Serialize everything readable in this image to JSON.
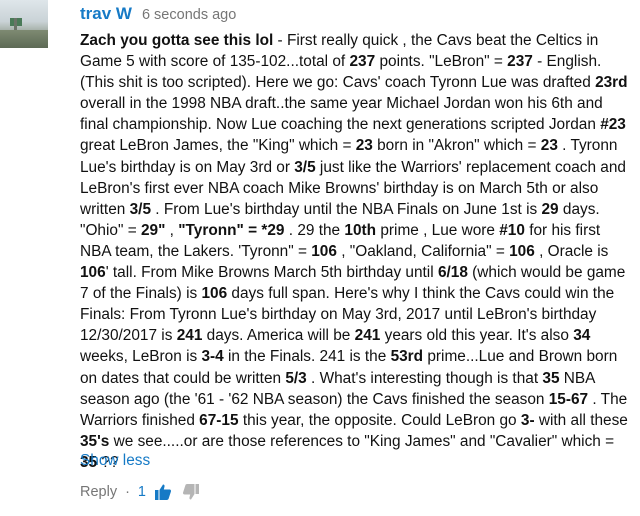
{
  "comment": {
    "author": "trav W",
    "time": "6 seconds ago",
    "segments": [
      {
        "t": "Zach you gotta see this lol",
        "b": true
      },
      {
        "t": " - First really quick , the Cavs beat the Celtics in Game 5 with score of  135-102...total of "
      },
      {
        "t": "237",
        "b": true
      },
      {
        "t": " points. \"LeBron\" = "
      },
      {
        "t": "237",
        "b": true
      },
      {
        "t": " - English. (This shit is too scripted). Here we go: Cavs' coach Tyronn Lue was drafted "
      },
      {
        "t": "23rd",
        "b": true
      },
      {
        "t": " overall in the 1998 NBA draft..the same year Michael Jordan won his 6th and final championship. Now Lue coaching the next generations scripted Jordan "
      },
      {
        "t": "#23",
        "b": true
      },
      {
        "t": " great LeBron James, the \"King\" which = "
      },
      {
        "t": "23",
        "b": true
      },
      {
        "t": " born in \"Akron\" which = "
      },
      {
        "t": "23",
        "b": true
      },
      {
        "t": " .  Tyronn Lue's birthday is on May 3rd or "
      },
      {
        "t": "3/5",
        "b": true
      },
      {
        "t": " just like the Warriors' replacement coach and LeBron's first ever NBA coach Mike Browns' birthday is on March 5th or also written "
      },
      {
        "t": "3/5",
        "b": true
      },
      {
        "t": " . From Lue's birthday until the NBA Finals on June 1st is "
      },
      {
        "t": "29",
        "b": true
      },
      {
        "t": " days. \"Ohio\" = "
      },
      {
        "t": "29\"",
        "b": true
      },
      {
        "t": " , "
      },
      {
        "t": "\"Tyronn\" = *29",
        "b": true
      },
      {
        "t": " . 29 the "
      },
      {
        "t": "10th",
        "b": true
      },
      {
        "t": " prime , Lue wore "
      },
      {
        "t": "#10",
        "b": true
      },
      {
        "t": " for his first NBA team, the Lakers. 'Tyronn\" = "
      },
      {
        "t": "106",
        "b": true
      },
      {
        "t": " , \"Oakland, California\" = "
      },
      {
        "t": "106",
        "b": true
      },
      {
        "t": " , Oracle is "
      },
      {
        "t": "106",
        "b": true
      },
      {
        "t": "' tall.  From Mike Browns March 5th birthday until "
      },
      {
        "t": "6/18",
        "b": true
      },
      {
        "t": " (which would be game 7 of the Finals) is "
      },
      {
        "t": "106",
        "b": true
      },
      {
        "t": " days full span. Here's why I think the Cavs could win the Finals: From Tyronn Lue's birthday on May 3rd, 2017 until LeBron's birthday 12/30/2017 is "
      },
      {
        "t": "241",
        "b": true
      },
      {
        "t": " days. America will be "
      },
      {
        "t": "241",
        "b": true
      },
      {
        "t": " years old this year. It's also "
      },
      {
        "t": "34",
        "b": true
      },
      {
        "t": " weeks, LeBron is "
      },
      {
        "t": "3-4",
        "b": true
      },
      {
        "t": " in the Finals.  241 is the "
      },
      {
        "t": "53rd",
        "b": true
      },
      {
        "t": " prime...Lue and Brown born on dates that could be written "
      },
      {
        "t": "5/3",
        "b": true
      },
      {
        "t": " . What's interesting though is that "
      },
      {
        "t": "35",
        "b": true
      },
      {
        "t": " NBA season ago (the '61 - '62 NBA season) the Cavs finished the season "
      },
      {
        "t": "15-67",
        "b": true
      },
      {
        "t": " . The Warriors finished "
      },
      {
        "t": "67-15",
        "b": true
      },
      {
        "t": " this year, the opposite.  Could LeBron go "
      },
      {
        "t": "3-",
        "b": true
      },
      {
        "t": " with all these "
      },
      {
        "t": "35's",
        "b": true
      },
      {
        "t": " we see.....or are those references to \"King James\" and \"Cavalier\" which = "
      },
      {
        "t": "35",
        "b": true
      },
      {
        "t": " ??"
      }
    ],
    "show_less": "Show less",
    "reply_label": "Reply",
    "separator": "·",
    "like_count": "1"
  },
  "colors": {
    "link": "#167ac6",
    "meta": "#767676",
    "text": "#111111"
  },
  "icons": {
    "like": "thumb-up-icon",
    "dislike": "thumb-down-icon"
  }
}
